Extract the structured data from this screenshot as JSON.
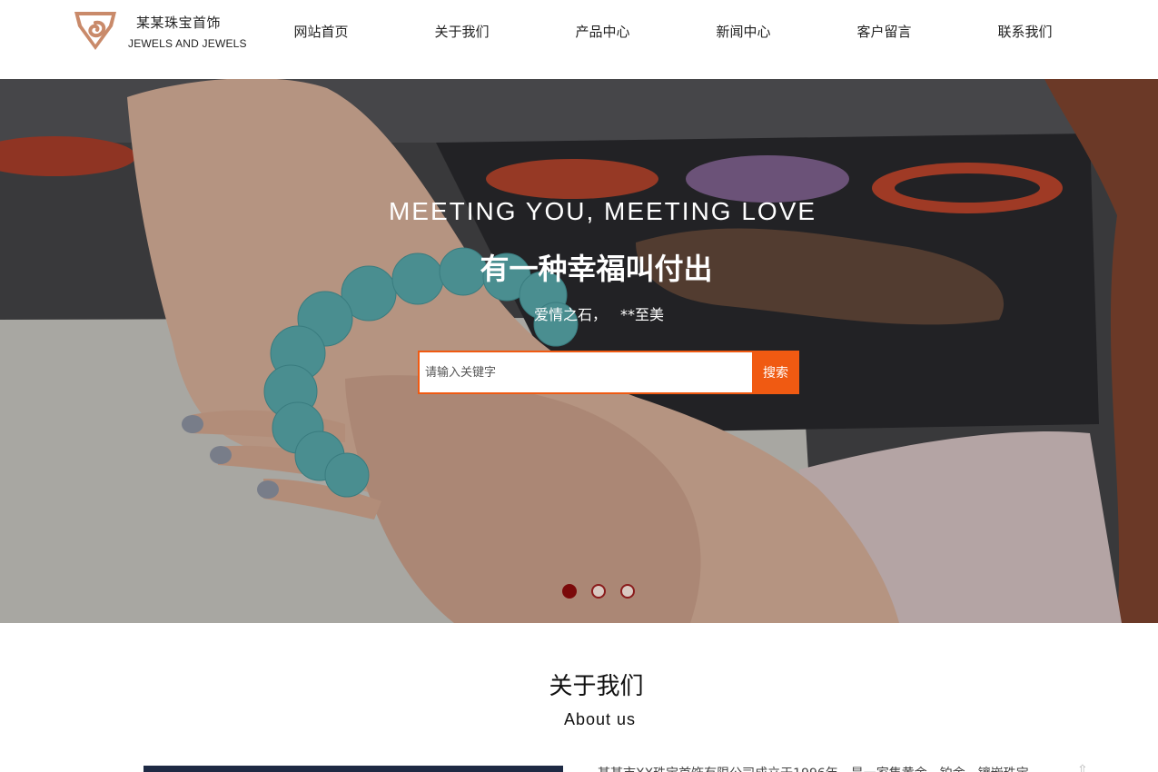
{
  "header": {
    "logo_cn": "某某珠宝首饰",
    "logo_en": "JEWELS AND JEWELS",
    "nav": [
      {
        "label": "网站首页"
      },
      {
        "label": "关于我们"
      },
      {
        "label": "产品中心"
      },
      {
        "label": "新闻中心"
      },
      {
        "label": "客户留言"
      },
      {
        "label": "联系我们"
      }
    ]
  },
  "banner": {
    "headline_en": "MEETING YOU, MEETING LOVE",
    "headline_cn": "有一种幸福叫付出",
    "subline": "爱情之石， **至美",
    "search_placeholder": "请输入关键字",
    "search_button": "搜索",
    "active_slide": 1,
    "slide_count": 3
  },
  "about": {
    "title": "关于我们",
    "subtitle": "About us",
    "text": "某某市XX珠宝首饰有限公司成立于1996年，是一家集黄金、铂金、镶嵌珠宝"
  },
  "colors": {
    "accent": "#f05a12",
    "dot_active": "#7b0a0a",
    "logo": "#c98a6a"
  }
}
